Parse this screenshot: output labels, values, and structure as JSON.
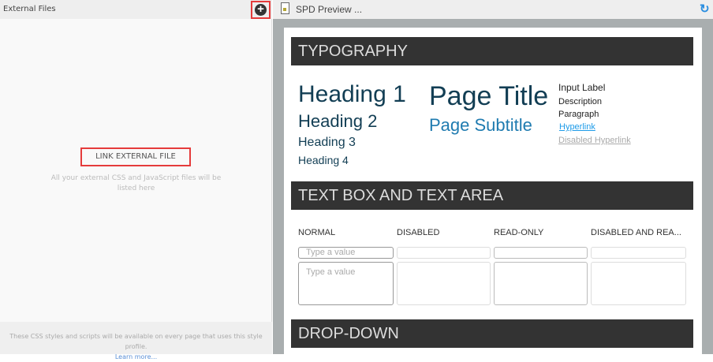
{
  "left_panel": {
    "title": "External Files",
    "add_icon": "plus-circle-icon",
    "link_button": "LINK EXTERNAL FILE",
    "hint": "All your external CSS and JavaScript files will be listed here",
    "footer_text": "These CSS styles and scripts will be available on every page that uses this style profile.",
    "learn_more": "Learn more..."
  },
  "preview": {
    "title": "SPD Preview ...",
    "refresh_icon": "refresh-icon",
    "sections": {
      "typography": "TYPOGRAPHY",
      "textbox": "TEXT BOX AND TEXT AREA",
      "dropdown": "DROP-DOWN"
    },
    "typography": {
      "h1": "Heading 1",
      "h2": "Heading 2",
      "h3": "Heading 3",
      "h4": "Heading 4",
      "page_title": "Page Title",
      "page_subtitle": "Page Subtitle",
      "input_label": "Input Label",
      "description": "Description",
      "paragraph": "Paragraph",
      "hyperlink": "Hyperlink",
      "disabled_hyperlink": "Disabled Hyperlink"
    },
    "textbox": {
      "columns": [
        "NORMAL",
        "DISABLED",
        "READ-ONLY",
        "DISABLED AND REA..."
      ],
      "placeholder": "Type a value"
    }
  }
}
